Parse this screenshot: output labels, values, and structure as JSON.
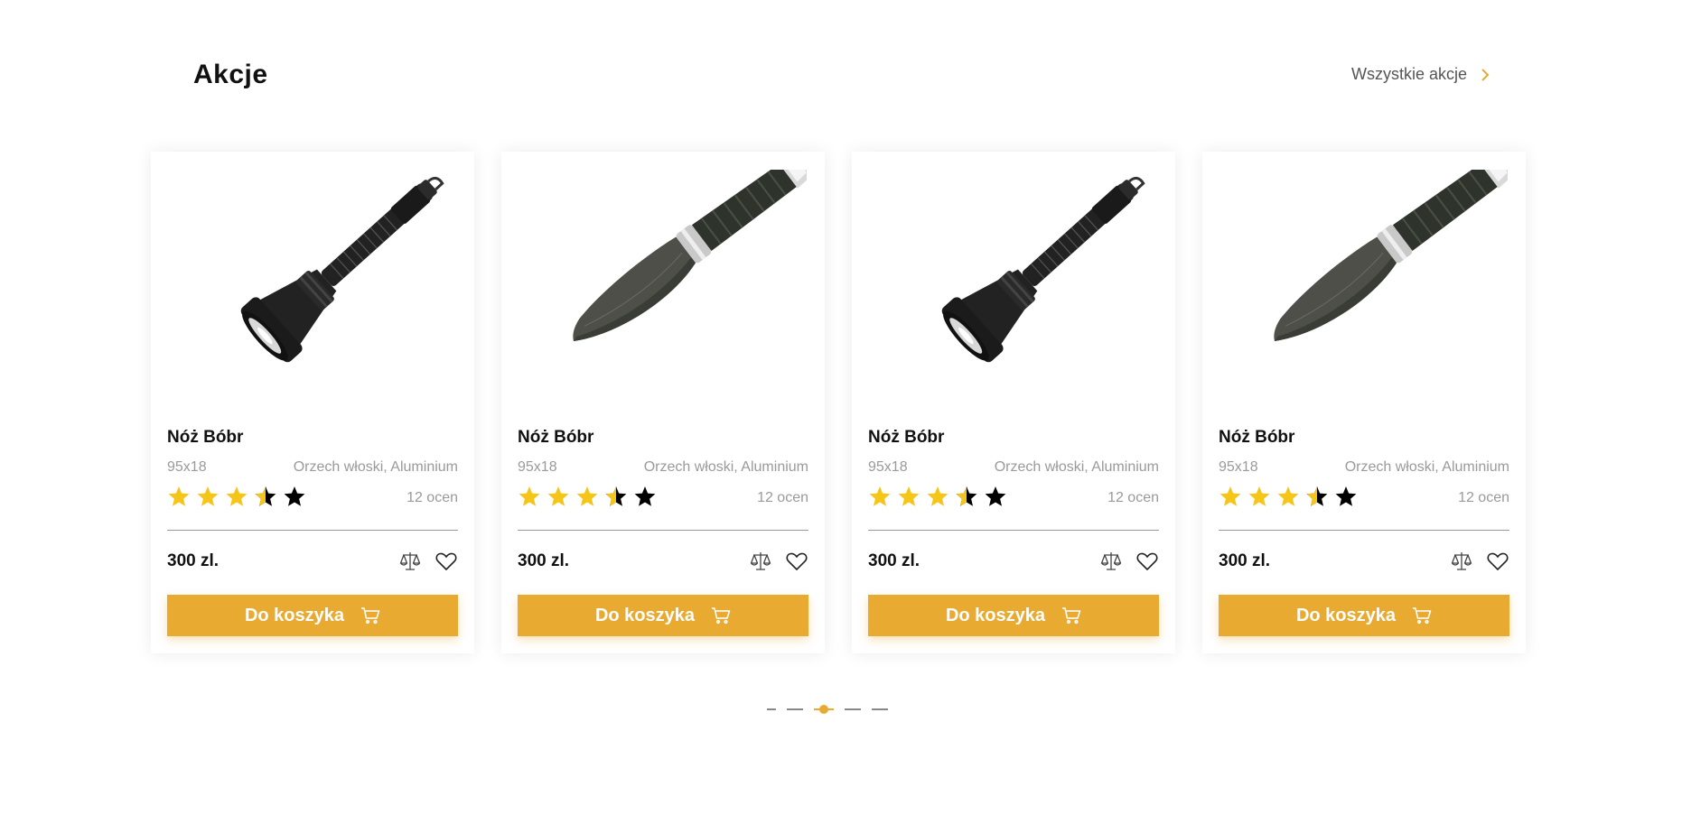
{
  "section": {
    "title": "Akcje",
    "all_link_label": "Wszystkie akcje"
  },
  "colors": {
    "accent": "#e8aa31",
    "star_filled": "#f5c518",
    "star_empty": "#000000"
  },
  "products": [
    {
      "image": "flashlight-image",
      "name": "Nóż Bóbr",
      "size": "95x18",
      "material": "Orzech włoski, Aluminium",
      "rating": 3.5,
      "rating_max": 5,
      "reviews": "12 ocen",
      "price": "300 zl.",
      "cart_label": "Do koszyka"
    },
    {
      "image": "knife-image",
      "name": "Nóż Bóbr",
      "size": "95x18",
      "material": "Orzech włoski, Aluminium",
      "rating": 3.5,
      "rating_max": 5,
      "reviews": "12 ocen",
      "price": "300 zl.",
      "cart_label": "Do koszyka"
    },
    {
      "image": "flashlight-image",
      "name": "Nóż Bóbr",
      "size": "95x18",
      "material": "Orzech włoski, Aluminium",
      "rating": 3.5,
      "rating_max": 5,
      "reviews": "12 ocen",
      "price": "300 zl.",
      "cart_label": "Do koszyka"
    },
    {
      "image": "knife-image",
      "name": "Nóż Bóbr",
      "size": "95x18",
      "material": "Orzech włoski, Aluminium",
      "rating": 3.5,
      "rating_max": 5,
      "reviews": "12 ocen",
      "price": "300 zl.",
      "cart_label": "Do koszyka"
    }
  ],
  "pagination": {
    "pages": 5,
    "active_page": 3
  }
}
